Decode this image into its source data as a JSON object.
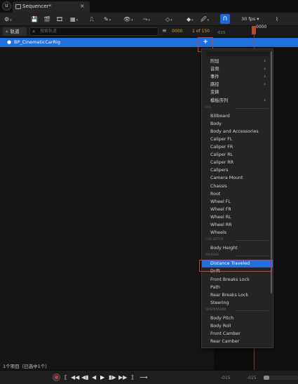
{
  "app": {
    "logo": "U",
    "tab_title": "Sequencer*",
    "tab_close": "×"
  },
  "toolbar": {
    "items": [
      {
        "name": "cog-icon",
        "glyph": "⚙"
      },
      {
        "name": "save-icon",
        "glyph": "💾"
      },
      {
        "name": "camera-icon",
        "glyph": "🎬"
      },
      {
        "name": "render-icon",
        "glyph": "🎞"
      },
      {
        "name": "key-icon",
        "glyph": "⎍"
      },
      {
        "name": "brush-icon",
        "glyph": "✎"
      },
      {
        "name": "eye-icon",
        "glyph": "👁"
      },
      {
        "name": "curve-icon",
        "glyph": "⤳"
      },
      {
        "name": "diamond-icon",
        "glyph": "◇"
      },
      {
        "name": "key-filled-icon",
        "glyph": "◆"
      },
      {
        "name": "pen-icon",
        "glyph": "🖉"
      }
    ],
    "snap_glyph": "∩",
    "fps_label": "30 fps",
    "curve_glyph": "⌇"
  },
  "header": {
    "add_track_label": "轨道",
    "search_placeholder": "搜索轨道",
    "frame_current": "0000",
    "frame_total": "1 of 150"
  },
  "ruler": {
    "left_label": "-015",
    "playhead_label": "0000"
  },
  "track": {
    "label": "BP_CinematicCarRig",
    "add_glyph": "+"
  },
  "menu": {
    "items": [
      {
        "type": "item",
        "label": "附加",
        "submenu": true
      },
      {
        "type": "item",
        "label": "音频",
        "submenu": true
      },
      {
        "type": "item",
        "label": "事件",
        "submenu": true
      },
      {
        "type": "item",
        "label": "路径",
        "submenu": true
      },
      {
        "type": "item",
        "label": "变换",
        "submenu": false
      },
      {
        "type": "item",
        "label": "模板序列",
        "submenu": true
      },
      {
        "type": "section",
        "label": "RIG"
      },
      {
        "type": "item",
        "label": "Billboard"
      },
      {
        "type": "item",
        "label": "Body"
      },
      {
        "type": "item",
        "label": "Body and Accessories"
      },
      {
        "type": "item",
        "label": "Caliper FL"
      },
      {
        "type": "item",
        "label": "Caliper FR"
      },
      {
        "type": "item",
        "label": "Caliper RL"
      },
      {
        "type": "item",
        "label": "Caliper RR"
      },
      {
        "type": "item",
        "label": "Calipers"
      },
      {
        "type": "item",
        "label": "Camera Mount"
      },
      {
        "type": "item",
        "label": "Chassis"
      },
      {
        "type": "item",
        "label": "Root"
      },
      {
        "type": "item",
        "label": "Wheel FL"
      },
      {
        "type": "item",
        "label": "Wheel FR"
      },
      {
        "type": "item",
        "label": "Wheel RL"
      },
      {
        "type": "item",
        "label": "Wheel RR"
      },
      {
        "type": "item",
        "label": "Wheels"
      },
      {
        "type": "section",
        "label": "CAR SETUP"
      },
      {
        "type": "item",
        "label": "Body Height"
      },
      {
        "type": "section",
        "label": "DRIVING"
      },
      {
        "type": "item",
        "label": "Distance Traveled",
        "selected": true
      },
      {
        "type": "item",
        "label": "Drift"
      },
      {
        "type": "item",
        "label": "Front Breaks Lock"
      },
      {
        "type": "item",
        "label": "Path"
      },
      {
        "type": "item",
        "label": "Rear Breaks Lock"
      },
      {
        "type": "item",
        "label": "Steering"
      },
      {
        "type": "section",
        "label": "SUSPENSION"
      },
      {
        "type": "item",
        "label": "Body Pitch"
      },
      {
        "type": "item",
        "label": "Body Roll"
      },
      {
        "type": "item",
        "label": "Front Camber"
      },
      {
        "type": "item",
        "label": "Rear Camber"
      }
    ]
  },
  "status": {
    "text": "1个项目（已选中1个）"
  },
  "transport": {
    "controls": [
      {
        "name": "jump-to-start-icon",
        "glyph": "⟦"
      },
      {
        "name": "prev-key-icon",
        "glyph": "◀◀"
      },
      {
        "name": "prev-frame-icon",
        "glyph": "◀▮"
      },
      {
        "name": "play-reverse-icon",
        "glyph": "◀"
      },
      {
        "name": "play-icon",
        "glyph": "▶"
      },
      {
        "name": "next-frame-icon",
        "glyph": "▮▶"
      },
      {
        "name": "next-key-icon",
        "glyph": "▶▶"
      },
      {
        "name": "jump-to-end-icon",
        "glyph": "⟧"
      },
      {
        "name": "loop-icon",
        "glyph": "⟶"
      }
    ],
    "start": "-015",
    "end": "-015"
  }
}
